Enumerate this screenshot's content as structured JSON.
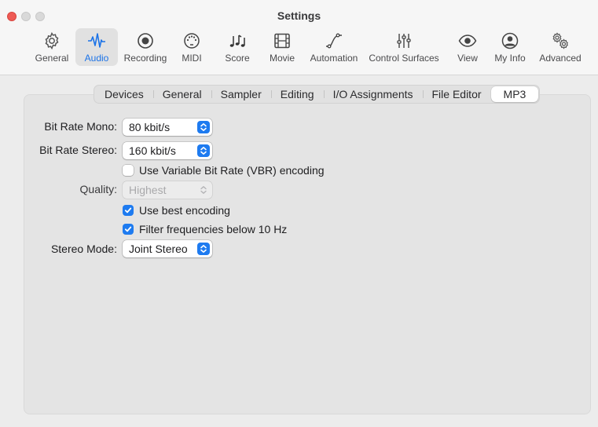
{
  "window": {
    "title": "Settings"
  },
  "toolbar": {
    "items": [
      {
        "label": "General",
        "icon": "gear-icon",
        "active": false
      },
      {
        "label": "Audio",
        "icon": "audio-waveform-icon",
        "active": true
      },
      {
        "label": "Recording",
        "icon": "record-icon",
        "active": false
      },
      {
        "label": "MIDI",
        "icon": "midi-port-icon",
        "active": false
      },
      {
        "label": "Score",
        "icon": "music-notes-icon",
        "active": false
      },
      {
        "label": "Movie",
        "icon": "film-icon",
        "active": false
      },
      {
        "label": "Automation",
        "icon": "automation-curve-icon",
        "active": false
      },
      {
        "label": "Control Surfaces",
        "icon": "faders-icon",
        "active": false
      },
      {
        "label": "View",
        "icon": "eye-icon",
        "active": false
      },
      {
        "label": "My Info",
        "icon": "person-icon",
        "active": false
      },
      {
        "label": "Advanced",
        "icon": "gears-icon",
        "active": false
      }
    ]
  },
  "tabs": {
    "items": [
      "Devices",
      "General",
      "Sampler",
      "Editing",
      "I/O Assignments",
      "File Editor",
      "MP3"
    ],
    "selected": "MP3"
  },
  "form": {
    "bit_rate_mono": {
      "label": "Bit Rate Mono:",
      "value": "80 kbit/s"
    },
    "bit_rate_stereo": {
      "label": "Bit Rate Stereo:",
      "value": "160 kbit/s"
    },
    "vbr": {
      "label": "Use Variable Bit Rate (VBR) encoding",
      "checked": false
    },
    "quality": {
      "label": "Quality:",
      "value": "Highest",
      "enabled": false
    },
    "best_encoding": {
      "label": "Use best encoding",
      "checked": true
    },
    "filter_freq": {
      "label": "Filter frequencies below 10 Hz",
      "checked": true
    },
    "stereo_mode": {
      "label": "Stereo Mode:",
      "value": "Joint Stereo"
    }
  },
  "colors": {
    "accent": "#1e7bf0",
    "close_button": "#ee5b55"
  }
}
